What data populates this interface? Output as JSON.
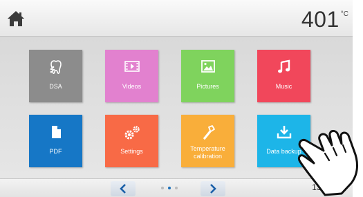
{
  "header": {
    "home_icon": "home-icon",
    "temperature_value": "401",
    "temperature_unit": "°C"
  },
  "tiles": [
    {
      "label": "DSA",
      "icon": "tooth-dsa-icon",
      "color": "#8c8c8c"
    },
    {
      "label": "Videos",
      "icon": "film-icon",
      "color": "#e281cf"
    },
    {
      "label": "Pictures",
      "icon": "picture-icon",
      "color": "#7fd35d"
    },
    {
      "label": "Music",
      "icon": "music-note-icon",
      "color": "#f1475b"
    },
    {
      "label": "PDF",
      "icon": "document-icon",
      "color": "#1677c6"
    },
    {
      "label": "Settings",
      "icon": "gears-icon",
      "color": "#f86a46"
    },
    {
      "label_line1": "Temperature",
      "label_line2": "calibration",
      "icon": "thermometer-icon",
      "color": "#f9ae3a"
    },
    {
      "label": "Data backup",
      "icon": "download-icon",
      "color": "#1db5e8"
    }
  ],
  "footer": {
    "prev_icon": "chevron-left-icon",
    "next_icon": "chevron-right-icon",
    "page_dots": 3,
    "active_page": 2,
    "time": "13:59:26"
  }
}
